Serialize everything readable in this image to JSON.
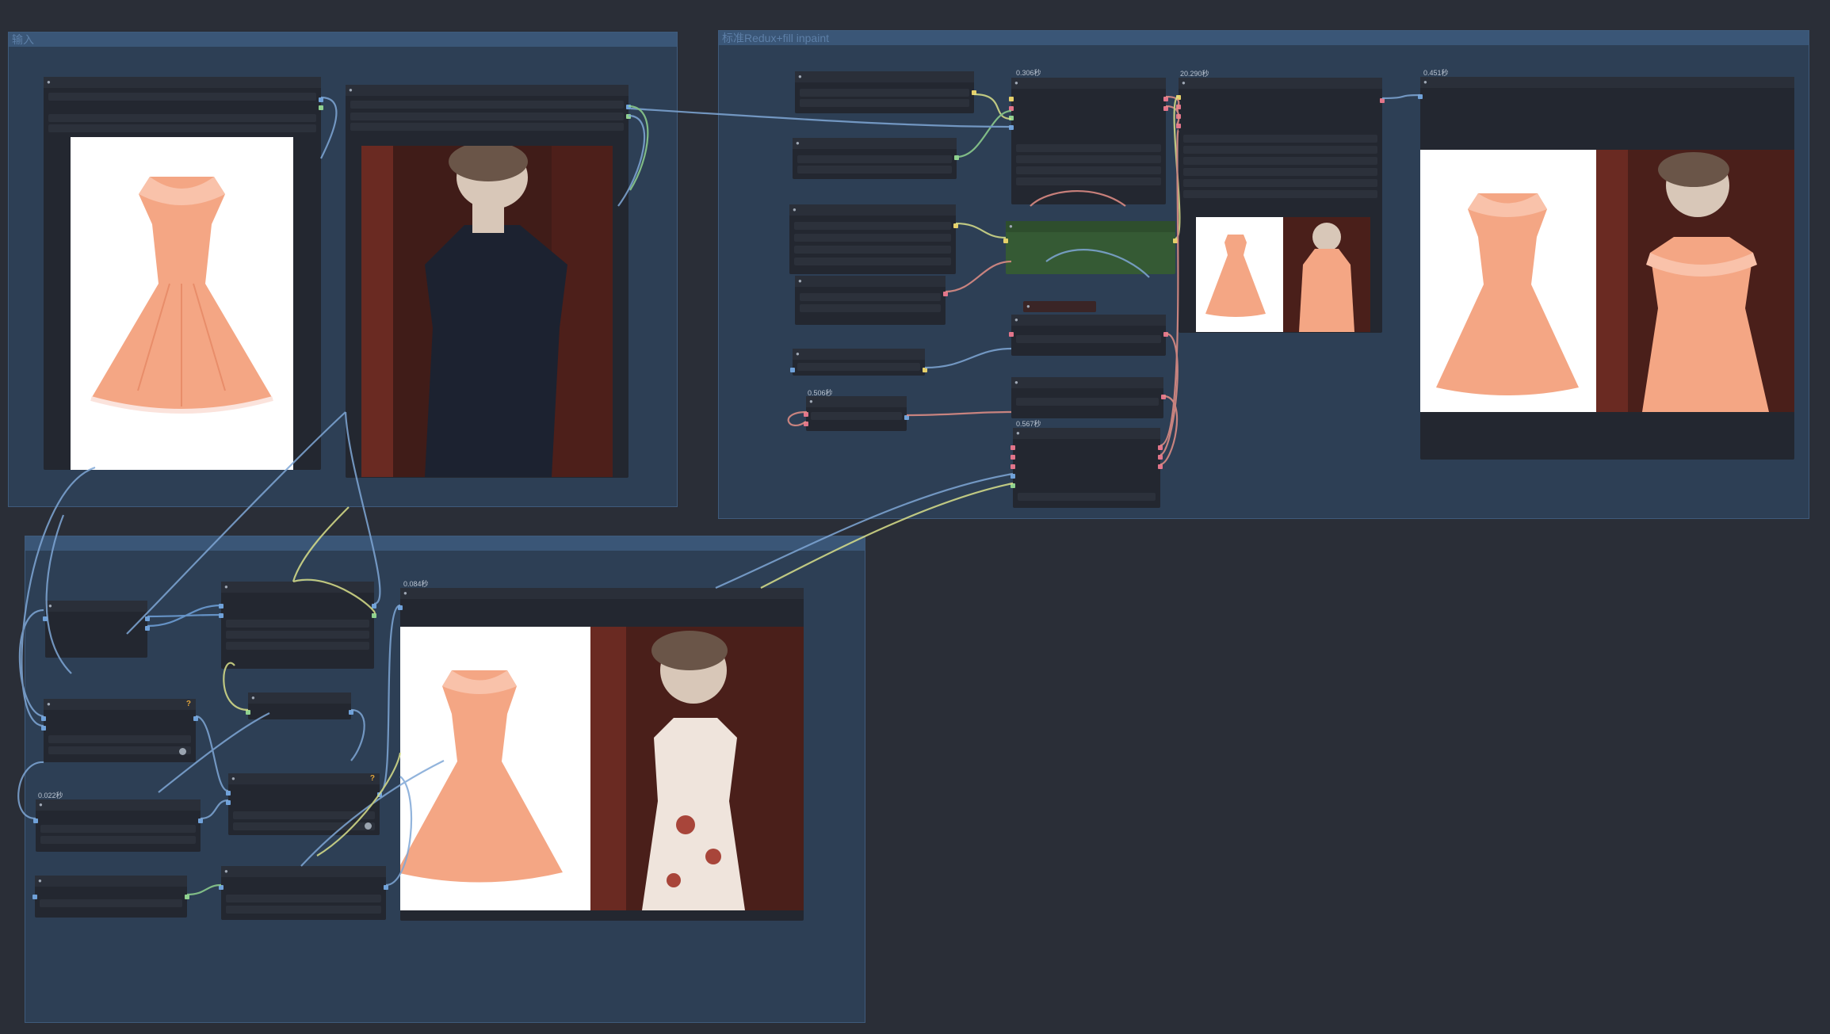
{
  "canvas": {
    "background": "#2a2e37"
  },
  "groups": [
    {
      "id": "input",
      "title": "输入"
    },
    {
      "id": "redux",
      "title": "标准Redux+fill inpaint"
    },
    {
      "id": "extra",
      "title": ""
    }
  ],
  "timings": {
    "t1": "0.306秒",
    "t2": "20.290秒",
    "t3": "0.451秒",
    "t4": "0.506秒",
    "t5": "0.567秒",
    "t6": "0.084秒",
    "t7": "0.022秒"
  },
  "colors": {
    "link_blue": "#7fa7d6",
    "link_yellow": "#d9e08a",
    "link_pink": "#e48f87",
    "port_blue": "#6fa1d9",
    "port_green": "#8fd18f",
    "port_pink": "#e2758a",
    "port_yellow": "#e6d06a",
    "dress": "#f4a684",
    "green_node": "#355a34"
  },
  "icons": {
    "warning": "?"
  }
}
